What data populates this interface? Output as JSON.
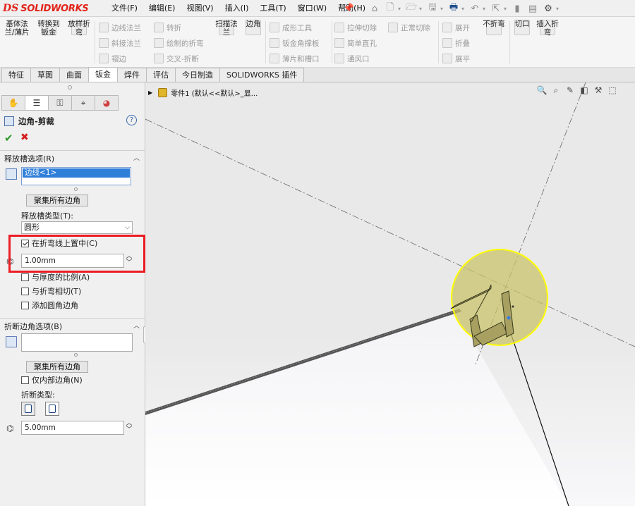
{
  "app": {
    "brand": "SOLIDWORKS",
    "brand_prefix": "DS"
  },
  "menu": [
    "文件(F)",
    "编辑(E)",
    "视图(V)",
    "插入(I)",
    "工具(T)",
    "窗口(W)",
    "帮助(H)"
  ],
  "quick_access": [
    "home-icon",
    "new-doc-icon",
    "open-icon",
    "save-icon",
    "print-icon",
    "undo-icon",
    "select-icon",
    "rebuild-icon",
    "file-props-icon",
    "options-icon"
  ],
  "ribbon": {
    "big_buttons": [
      {
        "label": "基体法\n兰/薄片",
        "name": "base-flange"
      },
      {
        "label": "转换到\n钣金",
        "name": "convert-to-sheet-metal"
      },
      {
        "label": "放样折\n弯",
        "name": "lofted-bend"
      },
      {
        "label": "扫描法\n兰",
        "name": "swept-flange"
      },
      {
        "label": "边角",
        "name": "corners"
      },
      {
        "label": "不折弯",
        "name": "unfold"
      },
      {
        "label": "切口",
        "name": "rip"
      },
      {
        "label": "插入折\n弯",
        "name": "insert-bends"
      }
    ],
    "small_buttons": [
      {
        "label": "边线法兰",
        "name": "edge-flange"
      },
      {
        "label": "斜接法兰",
        "name": "miter-flange"
      },
      {
        "label": "褶边",
        "name": "hem"
      },
      {
        "label": "转折",
        "name": "jog"
      },
      {
        "label": "绘制的折弯",
        "name": "sketched-bend"
      },
      {
        "label": "交叉-折断",
        "name": "cross-break"
      },
      {
        "label": "成形工具",
        "name": "forming-tool"
      },
      {
        "label": "钣金角撑板",
        "name": "sheet-metal-gusset"
      },
      {
        "label": "薄片和槽口",
        "name": "tab-and-slot"
      },
      {
        "label": "拉伸切除",
        "name": "extruded-cut"
      },
      {
        "label": "简单直孔",
        "name": "simple-hole"
      },
      {
        "label": "通风口",
        "name": "vent"
      },
      {
        "label": "正常切除",
        "name": "normal-cut"
      },
      {
        "label": "展开",
        "name": "unfold-small"
      },
      {
        "label": "折叠",
        "name": "fold"
      },
      {
        "label": "展平",
        "name": "flatten"
      }
    ]
  },
  "tabs": [
    "特征",
    "草图",
    "曲面",
    "钣金",
    "焊件",
    "评估",
    "今日制造",
    "SOLIDWORKS 插件"
  ],
  "active_tab": "钣金",
  "tree": {
    "part_label": "零件1  (默认<<默认>_显..."
  },
  "property_manager": {
    "title": "边角-剪裁",
    "help": "?",
    "ok": "✔",
    "cancel": "✖",
    "relief_section": {
      "title": "释放槽选项(R)",
      "selected_item": "边线<1>",
      "collect_button": "聚集所有边角",
      "relief_type_label": "释放槽类型(T):",
      "relief_type_value": "圆形",
      "center_on_bend_label": "在折弯线上置中(C)",
      "center_on_bend_checked": true,
      "size_value": "1.00mm",
      "ratio_label": "与厚度的比例(A)",
      "ratio_checked": false,
      "tangent_label": "与折弯相切(T)",
      "tangent_checked": false,
      "fillet_label": "添加圆角边角",
      "fillet_checked": false
    },
    "break_section": {
      "title": "折断边角选项(B)",
      "collect_button": "聚集所有边角",
      "internal_only_label": "仅内部边角(N)",
      "internal_only_checked": false,
      "break_type_label": "折断类型:",
      "distance_value": "5.00mm"
    }
  }
}
